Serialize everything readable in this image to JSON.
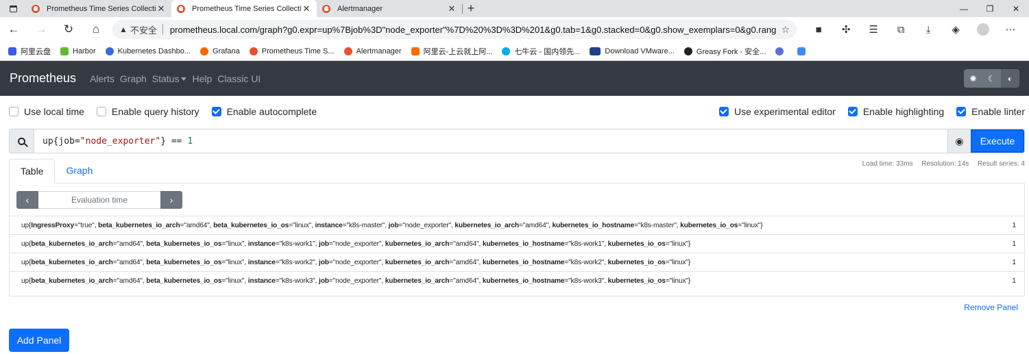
{
  "browser": {
    "tabs": [
      {
        "title": "Prometheus Time Series Collection and Processing Server",
        "active": false
      },
      {
        "title": "Prometheus Time Series Collection and Processing Server",
        "active": true
      },
      {
        "title": "Alertmanager",
        "active": false
      }
    ],
    "new_tab": "+",
    "security_label": "不安全",
    "url": "prometheus.local.com/graph?g0.expr=up%7Bjob%3D\"node_exporter\"%7D%20%3D%3D%201&g0.tab=1&g0.stacked=0&g0.show_exemplars=0&g0.range_...",
    "bookmarks": [
      {
        "label": "阿里云盘",
        "color": "#3b5ce4"
      },
      {
        "label": "Harbor",
        "color": "#60b932"
      },
      {
        "label": "Kubernetes Dashbo...",
        "color": "#326ce5"
      },
      {
        "label": "Grafana",
        "color": "#f46800"
      },
      {
        "label": "Prometheus Time S...",
        "color": "#e6522c"
      },
      {
        "label": "Alertmanager",
        "color": "#e6522c"
      },
      {
        "label": "阿里云-上云就上阿...",
        "color": "#ff6a00"
      },
      {
        "label": "七牛云 - 国内领先...",
        "color": "#06aeef"
      },
      {
        "label": "Download VMware...",
        "color": "#1d428a"
      },
      {
        "label": "Greasy Fork - 安全...",
        "color": "#222222"
      },
      {
        "label": "",
        "color": "#5b6fd6"
      },
      {
        "label": "",
        "color": "#3f8cf0"
      }
    ]
  },
  "app": {
    "brand": "Prometheus",
    "nav": [
      "Alerts",
      "Graph",
      "Status",
      "Help",
      "Classic UI"
    ],
    "options_left": [
      {
        "label": "Use local time",
        "checked": false
      },
      {
        "label": "Enable query history",
        "checked": false
      },
      {
        "label": "Enable autocomplete",
        "checked": true
      }
    ],
    "options_right": [
      {
        "label": "Use experimental editor",
        "checked": true
      },
      {
        "label": "Enable highlighting",
        "checked": true
      },
      {
        "label": "Enable linter",
        "checked": true
      }
    ],
    "query": {
      "prefix": "up{job=",
      "string": "\"node_exporter\"",
      "op": "} == ",
      "number": "1"
    },
    "execute_label": "Execute",
    "panel_tabs": [
      "Table",
      "Graph"
    ],
    "stats": {
      "load_time": "Load time: 33ms",
      "resolution": "Resolution: 14s",
      "result_series": "Result series: 4"
    },
    "evaluation_placeholder": "Evaluation time",
    "results": [
      {
        "labels": [
          [
            "IngressProxy",
            "\"true\""
          ],
          [
            "beta_kubernetes_io_arch",
            "\"amd64\""
          ],
          [
            "beta_kubernetes_io_os",
            "\"linux\""
          ],
          [
            "instance",
            "\"k8s-master\""
          ],
          [
            "job",
            "\"node_exporter\""
          ],
          [
            "kubernetes_io_arch",
            "\"amd64\""
          ],
          [
            "kubernetes_io_hostname",
            "\"k8s-master\""
          ],
          [
            "kubernetes_io_os",
            "\"linux\""
          ]
        ],
        "value": "1"
      },
      {
        "labels": [
          [
            "beta_kubernetes_io_arch",
            "\"amd64\""
          ],
          [
            "beta_kubernetes_io_os",
            "\"linux\""
          ],
          [
            "instance",
            "\"k8s-work1\""
          ],
          [
            "job",
            "\"node_exporter\""
          ],
          [
            "kubernetes_io_arch",
            "\"amd64\""
          ],
          [
            "kubernetes_io_hostname",
            "\"k8s-work1\""
          ],
          [
            "kubernetes_io_os",
            "\"linux\""
          ]
        ],
        "value": "1"
      },
      {
        "labels": [
          [
            "beta_kubernetes_io_arch",
            "\"amd64\""
          ],
          [
            "beta_kubernetes_io_os",
            "\"linux\""
          ],
          [
            "instance",
            "\"k8s-work2\""
          ],
          [
            "job",
            "\"node_exporter\""
          ],
          [
            "kubernetes_io_arch",
            "\"amd64\""
          ],
          [
            "kubernetes_io_hostname",
            "\"k8s-work2\""
          ],
          [
            "kubernetes_io_os",
            "\"linux\""
          ]
        ],
        "value": "1"
      },
      {
        "labels": [
          [
            "beta_kubernetes_io_arch",
            "\"amd64\""
          ],
          [
            "beta_kubernetes_io_os",
            "\"linux\""
          ],
          [
            "instance",
            "\"k8s-work3\""
          ],
          [
            "job",
            "\"node_exporter\""
          ],
          [
            "kubernetes_io_arch",
            "\"amd64\""
          ],
          [
            "kubernetes_io_hostname",
            "\"k8s-work3\""
          ],
          [
            "kubernetes_io_os",
            "\"linux\""
          ]
        ],
        "value": "1"
      }
    ],
    "remove_panel_label": "Remove Panel",
    "add_panel_label": "Add Panel"
  }
}
